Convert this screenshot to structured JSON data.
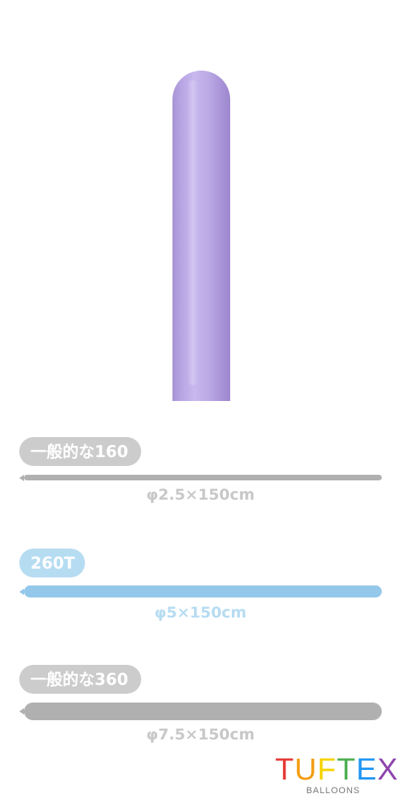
{
  "balloon": {
    "color": "#b7a4e3"
  },
  "rows": [
    {
      "tag": "一般的な160",
      "size": "φ2.5×150cm",
      "tag_color": "#cccccc",
      "bar_color": "#b0b0b0",
      "size_color": "#c8c8c8"
    },
    {
      "tag": "260T",
      "size": "φ5×150cm",
      "tag_color": "#b6dcf2",
      "bar_color": "#94c8ea",
      "size_color": "#b6dcf2"
    },
    {
      "tag": "一般的な360",
      "size": "φ7.5×150cm",
      "tag_color": "#cccccc",
      "bar_color": "#b0b0b0",
      "size_color": "#c8c8c8"
    }
  ],
  "logo": {
    "letters": [
      {
        "char": "T",
        "color": "#e53935"
      },
      {
        "char": "U",
        "color": "#f39c12"
      },
      {
        "char": "F",
        "color": "#f5d300"
      },
      {
        "char": "T",
        "color": "#4caf50"
      },
      {
        "char": "E",
        "color": "#2196f3"
      },
      {
        "char": "X",
        "color": "#8e44ad"
      }
    ],
    "subtitle": "BALLOONS"
  }
}
